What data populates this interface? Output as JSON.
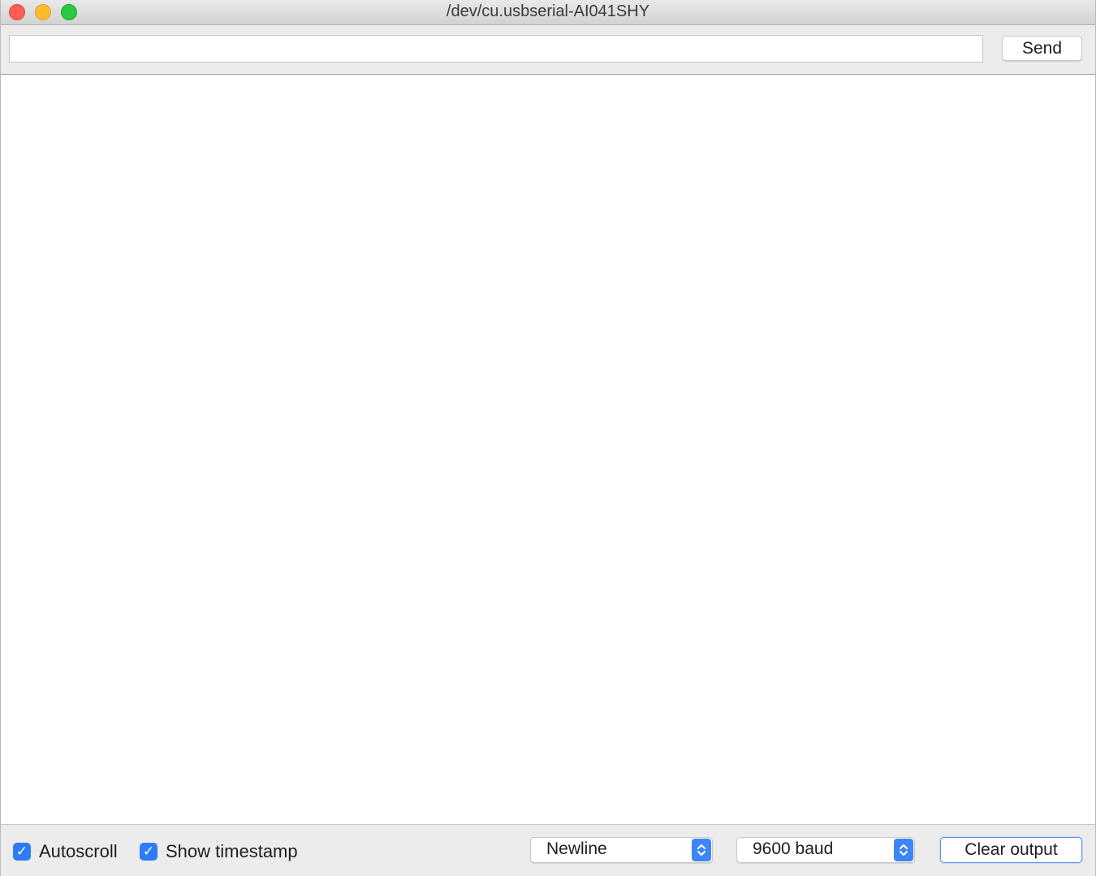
{
  "window": {
    "title": "/dev/cu.usbserial-AI041SHY"
  },
  "toolbar": {
    "input_value": "",
    "send_label": "Send"
  },
  "output": {
    "text": ""
  },
  "footer": {
    "autoscroll": {
      "label": "Autoscroll",
      "checked": true
    },
    "show_timestamp": {
      "label": "Show timestamp",
      "checked": true
    },
    "line_ending": {
      "selected": "Newline"
    },
    "baud_rate": {
      "selected": "9600 baud"
    },
    "clear_label": "Clear output"
  },
  "colors": {
    "accent": "#2e7cf6",
    "close": "#fc5f57",
    "minimize": "#fdbc2e",
    "zoom": "#29c840"
  }
}
